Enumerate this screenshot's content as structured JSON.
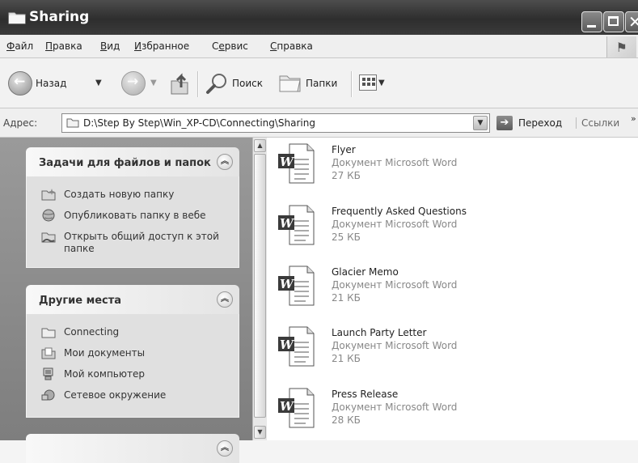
{
  "window": {
    "title": "Sharing",
    "icon": "folder-icon"
  },
  "menu": [
    {
      "key": "Ф",
      "rest": "айл"
    },
    {
      "key": "П",
      "rest": "равка"
    },
    {
      "key": "В",
      "rest": "ид"
    },
    {
      "key": "И",
      "rest": "збранное"
    },
    {
      "pre": "С",
      "key": "е",
      "rest": "рвис"
    },
    {
      "key": "С",
      "rest": "правка"
    }
  ],
  "toolbar": {
    "back_label": "Назад",
    "search_label": "Поиск",
    "folders_label": "Папки"
  },
  "address": {
    "label": "Адрес:",
    "path": "D:\\Step By Step\\Win_XP-CD\\Connecting\\Sharing",
    "go_label": "Переход",
    "links_label": "Ссылки"
  },
  "tasks_panel": {
    "title": "Задачи для файлов и папок",
    "items": [
      {
        "icon": "new-folder-icon",
        "label": "Создать новую папку"
      },
      {
        "icon": "web-publish-icon",
        "label": "Опубликовать папку в вебе"
      },
      {
        "icon": "share-folder-icon",
        "label": "Открыть общий доступ к этой папке"
      }
    ]
  },
  "places_panel": {
    "title": "Другие места",
    "items": [
      {
        "icon": "folder-icon",
        "label": "Connecting"
      },
      {
        "icon": "my-documents-icon",
        "label": "Мои документы"
      },
      {
        "icon": "my-computer-icon",
        "label": "Мой компьютер"
      },
      {
        "icon": "network-places-icon",
        "label": "Сетевое окружение"
      }
    ]
  },
  "files": [
    {
      "name": "Flyer",
      "type": "Документ Microsoft Word",
      "size": "27 КБ"
    },
    {
      "name": "Frequently Asked Questions",
      "type": "Документ Microsoft Word",
      "size": "25 КБ"
    },
    {
      "name": "Glacier Memo",
      "type": "Документ Microsoft Word",
      "size": "21 КБ"
    },
    {
      "name": "Launch Party Letter",
      "type": "Документ Microsoft Word",
      "size": "21 КБ"
    },
    {
      "name": "Press Release",
      "type": "Документ Microsoft Word",
      "size": "28 КБ"
    }
  ]
}
